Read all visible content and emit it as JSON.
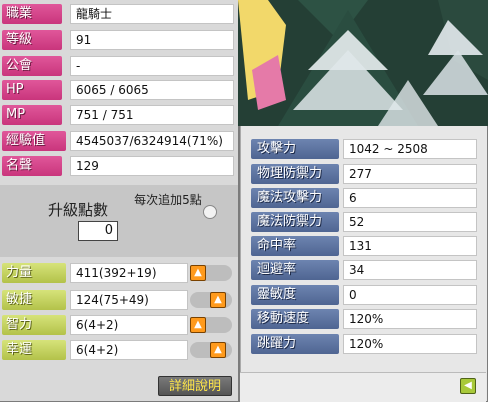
{
  "info": [
    {
      "label": "職業",
      "value": "龍騎士"
    },
    {
      "label": "等級",
      "value": "91"
    },
    {
      "label": "公會",
      "value": "-"
    },
    {
      "label": "HP",
      "value": "6065 / 6065"
    },
    {
      "label": "MP",
      "value": "751 / 751"
    },
    {
      "label": "經驗值",
      "value": "4545037/6324914(71%)"
    },
    {
      "label": "名聲",
      "value": "129"
    }
  ],
  "ap": {
    "title": "升級點數",
    "value": "0",
    "hint": "每次追加5點"
  },
  "stats": [
    {
      "label": "力量",
      "value": "411(392+19)"
    },
    {
      "label": "敏捷",
      "value": "124(75+49)"
    },
    {
      "label": "智力",
      "value": "6(4+2)"
    },
    {
      "label": "幸運",
      "value": "6(4+2)"
    }
  ],
  "detail_button": "詳細說明",
  "detail_stats": [
    {
      "label": "攻擊力",
      "value": "1042 ~ 2508"
    },
    {
      "label": "物理防禦力",
      "value": "277"
    },
    {
      "label": "魔法攻擊力",
      "value": "6"
    },
    {
      "label": "魔法防禦力",
      "value": "52"
    },
    {
      "label": "命中率",
      "value": "131"
    },
    {
      "label": "迴避率",
      "value": "34"
    },
    {
      "label": "靈敏度",
      "value": "0"
    },
    {
      "label": "移動速度",
      "value": "120%"
    },
    {
      "label": "跳躍力",
      "value": "120%"
    }
  ],
  "colors": {
    "pink_label": "#d24a8a",
    "green_label": "#c2d05b",
    "blue_label": "#5c72a0",
    "up_button": "#ff9a1c"
  },
  "icons": {
    "increase": "up-arrow-icon",
    "back": "left-arrow-icon",
    "toggle": "toggle-dot-icon"
  }
}
